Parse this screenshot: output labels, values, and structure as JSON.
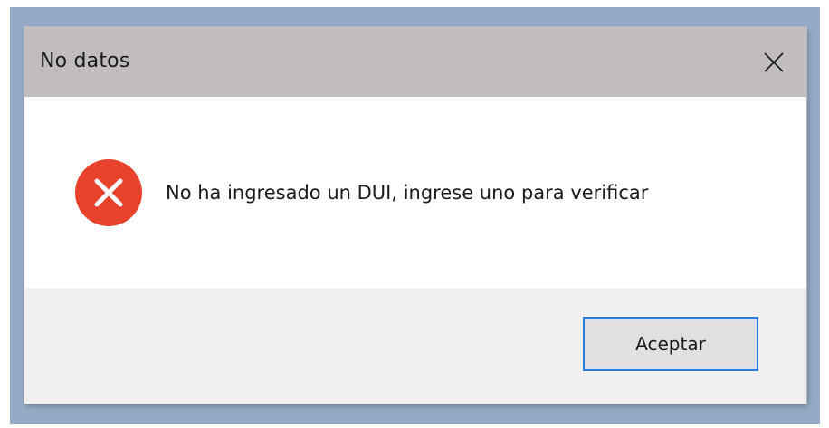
{
  "dialog": {
    "title": "No datos",
    "message": "No ha ingresado un DUI, ingrese uno para verificar",
    "icon": "error-icon",
    "ok_label": "Aceptar"
  },
  "colors": {
    "titlebar": "#c0bcc0",
    "error_red": "#e8412c",
    "button_focus": "#2f7bd9"
  }
}
